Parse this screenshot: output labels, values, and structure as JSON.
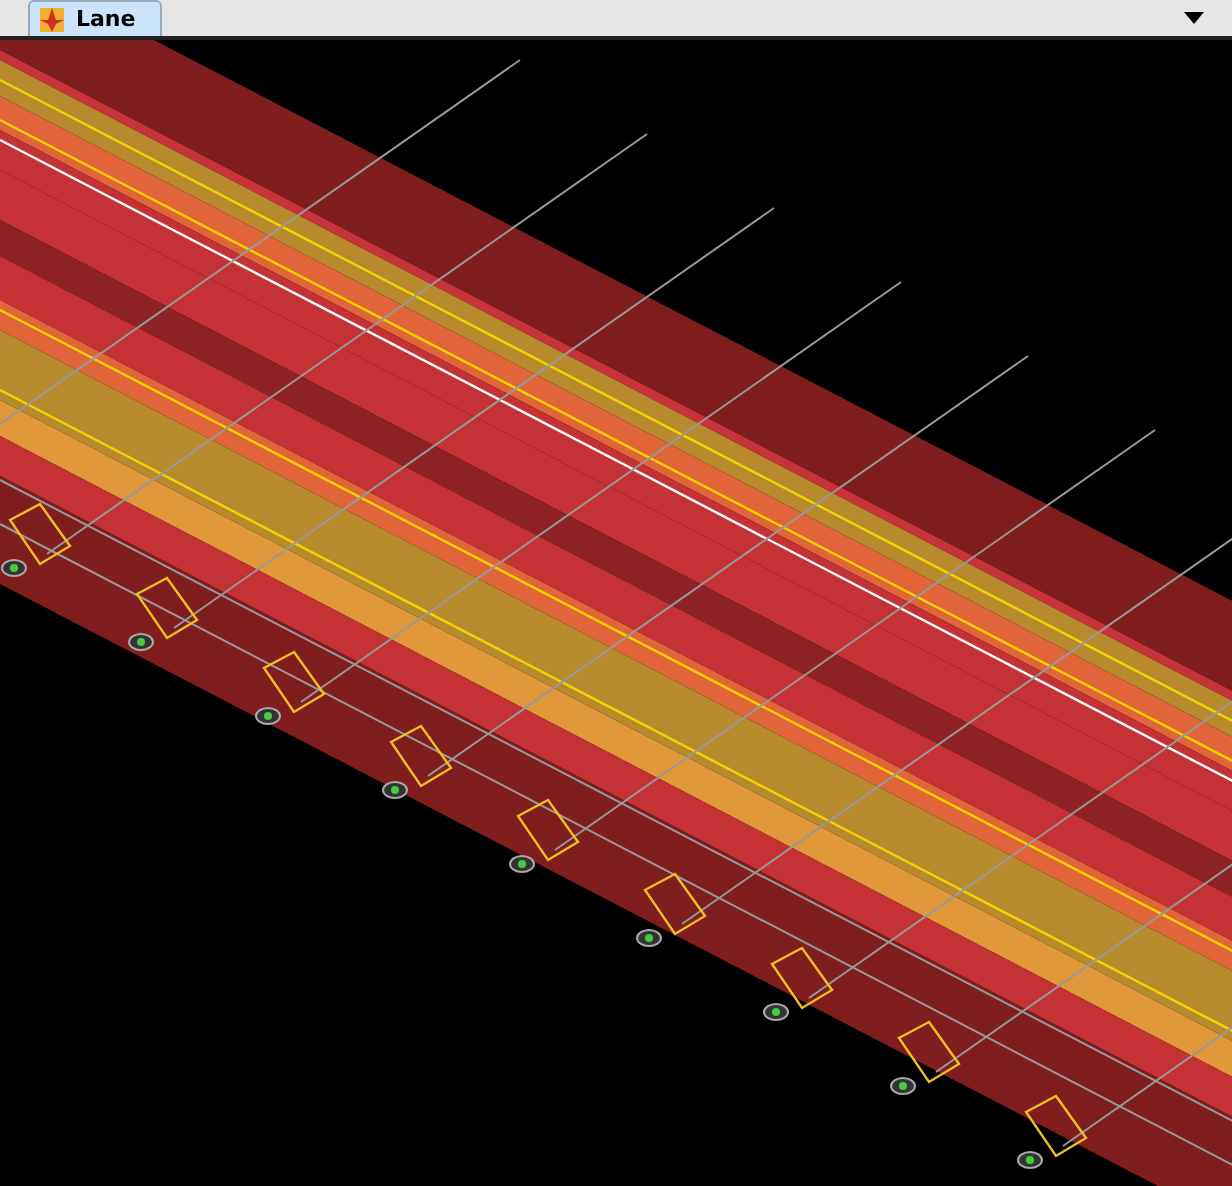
{
  "tabs": [
    {
      "label": "Lane",
      "selected": true
    }
  ]
}
